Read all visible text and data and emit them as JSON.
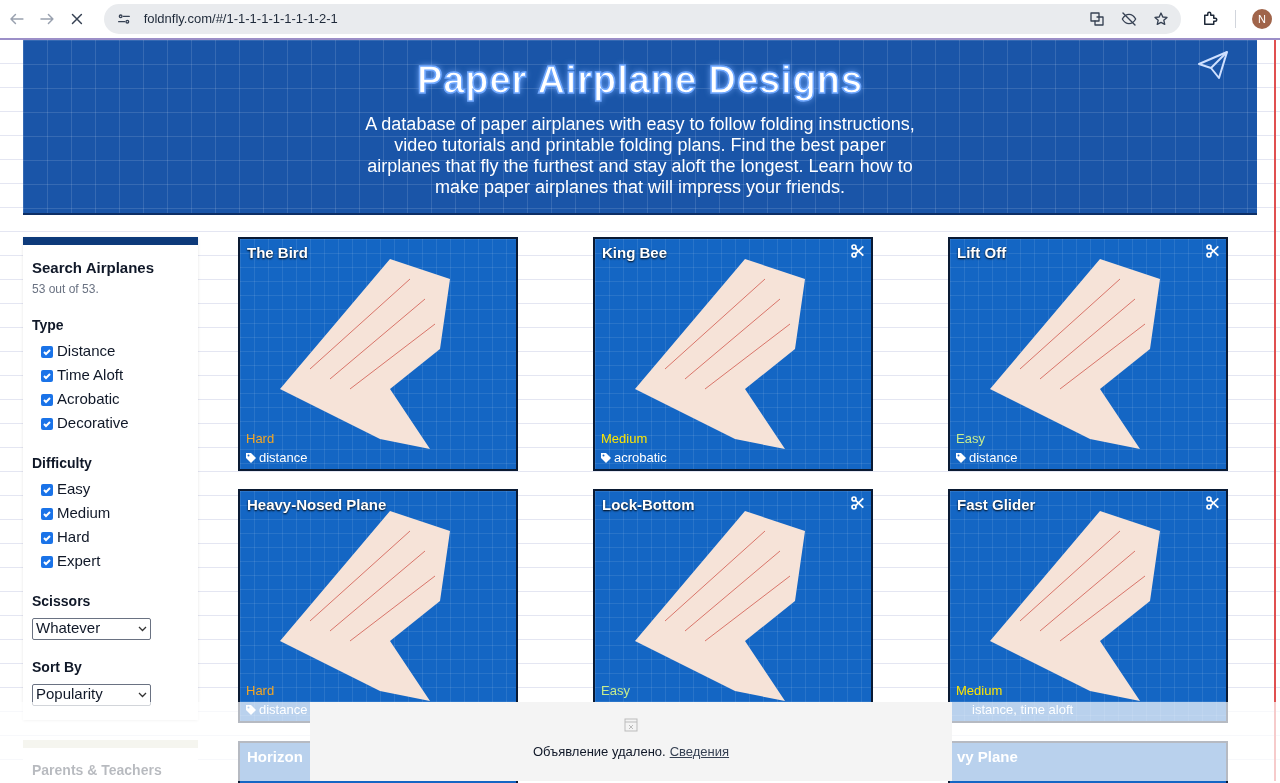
{
  "browser": {
    "url": "foldnfly.com/#/1-1-1-1-1-1-1-1-2-1",
    "avatar": "N"
  },
  "header": {
    "title": "Paper Airplane Designs",
    "description": "A database of paper airplanes with easy to follow folding instructions, video tutorials and printable folding plans. Find the best paper airplanes that fly the furthest and stay aloft the longest. Learn how to make paper airplanes that will impress your friends."
  },
  "sidebar": {
    "title": "Search Airplanes",
    "count": "53 out of 53.",
    "groups": [
      {
        "title": "Type",
        "options": [
          {
            "label": "Distance",
            "checked": true
          },
          {
            "label": "Time Aloft",
            "checked": true
          },
          {
            "label": "Acrobatic",
            "checked": true
          },
          {
            "label": "Decorative",
            "checked": true
          }
        ]
      },
      {
        "title": "Difficulty",
        "options": [
          {
            "label": "Easy",
            "checked": true
          },
          {
            "label": "Medium",
            "checked": true
          },
          {
            "label": "Hard",
            "checked": true
          },
          {
            "label": "Expert",
            "checked": true
          }
        ]
      }
    ],
    "selects": [
      {
        "title": "Scissors",
        "value": "Whatever"
      },
      {
        "title": "Sort By",
        "value": "Popularity"
      }
    ],
    "next_panel": "Parents & Teachers"
  },
  "cards": [
    {
      "title": "The Bird",
      "scissors": false,
      "difficulty": "Hard",
      "tag": "distance",
      "tag_icon": true
    },
    {
      "title": "King Bee",
      "scissors": true,
      "difficulty": "Medium",
      "tag": "acrobatic",
      "tag_icon": true
    },
    {
      "title": "Lift Off",
      "scissors": true,
      "difficulty": "Easy",
      "tag": "distance",
      "tag_icon": true
    },
    {
      "title": "Heavy-Nosed Plane",
      "scissors": false,
      "difficulty": "Hard",
      "tag": "distance",
      "tag_icon": true
    },
    {
      "title": "Lock-Bottom",
      "scissors": true,
      "difficulty": "Easy",
      "tag_icon": false
    },
    {
      "title": "Fast Glider",
      "scissors": true,
      "difficulty": "Medium",
      "tag": "istance, time aloft",
      "tag_icon": false
    }
  ],
  "next_cards": [
    "Horizon",
    "vy Plane"
  ],
  "ad_notice": {
    "text": "Объявление удалено.",
    "link": "Сведения"
  }
}
